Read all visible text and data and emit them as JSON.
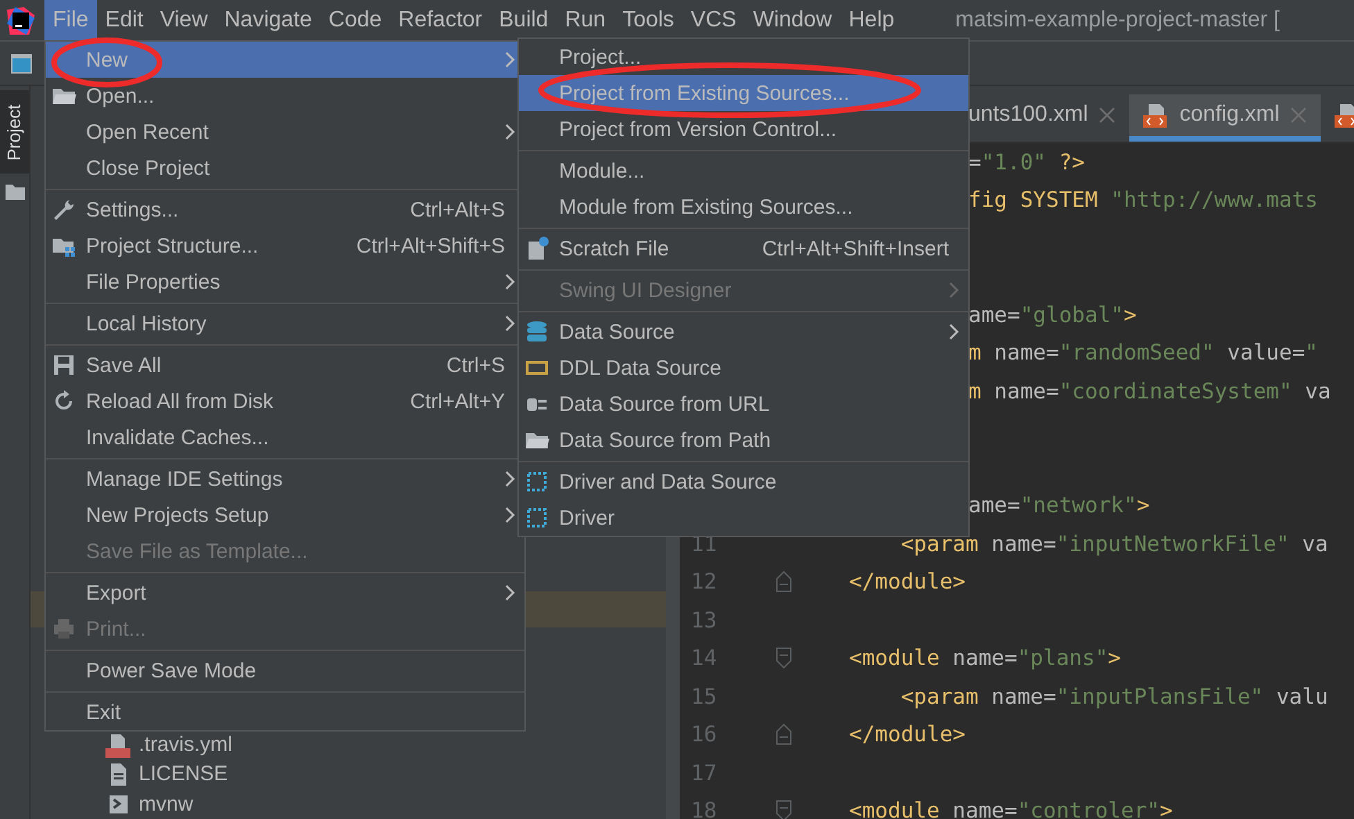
{
  "menu_bar": {
    "items": [
      {
        "label": "File",
        "selected": true
      },
      {
        "label": "Edit",
        "selected": false
      },
      {
        "label": "View",
        "selected": false
      },
      {
        "label": "Navigate",
        "selected": false
      },
      {
        "label": "Code",
        "selected": false
      },
      {
        "label": "Refactor",
        "selected": false
      },
      {
        "label": "Build",
        "selected": false
      },
      {
        "label": "Run",
        "selected": false
      },
      {
        "label": "Tools",
        "selected": false
      },
      {
        "label": "VCS",
        "selected": false
      },
      {
        "label": "Window",
        "selected": false
      },
      {
        "label": "Help",
        "selected": false
      }
    ],
    "title": "matsim-example-project-master ["
  },
  "tool_window_stripe": {
    "tab": {
      "label": "Project",
      "selected": true
    }
  },
  "project_tree": [
    {
      "label": ".travis.yml",
      "kind": "yml"
    },
    {
      "label": "LICENSE",
      "kind": "text"
    },
    {
      "label": "mvnw",
      "kind": "script"
    }
  ],
  "editor": {
    "tabs": [
      {
        "label": "unts100.xml",
        "selected": false
      },
      {
        "label": "config.xml",
        "selected": true
      },
      {
        "selected": false
      }
    ],
    "lines": [
      {
        "tokens": [
          {
            "kind": "plain",
            "text": "="
          },
          {
            "kind": "value",
            "text": "\"1.0\""
          },
          {
            "kind": "tag",
            "text": " ?>"
          }
        ]
      },
      {
        "tokens": [
          {
            "kind": "tag",
            "text": "fig SYSTEM "
          },
          {
            "kind": "value",
            "text": "\"http://www.mats"
          }
        ]
      },
      {
        "gap_before": true,
        "tokens": [
          {
            "kind": "plain",
            "text": "ame="
          },
          {
            "kind": "value",
            "text": "\"global\""
          },
          {
            "kind": "tag",
            "text": ">"
          }
        ]
      },
      {
        "tokens": [
          {
            "kind": "tag",
            "text": "m"
          },
          {
            "kind": "plain",
            "text": " name="
          },
          {
            "kind": "value",
            "text": "\"randomSeed\""
          },
          {
            "kind": "plain",
            "text": " value="
          },
          {
            "kind": "value",
            "text": "\""
          }
        ]
      },
      {
        "tokens": [
          {
            "kind": "tag",
            "text": "m"
          },
          {
            "kind": "plain",
            "text": " name="
          },
          {
            "kind": "value",
            "text": "\"coordinateSystem\""
          },
          {
            "kind": "plain",
            "text": " va"
          }
        ]
      },
      {
        "gap_before": true,
        "tokens": [
          {
            "kind": "plain",
            "text": "ame="
          },
          {
            "kind": "value",
            "text": "\"network\""
          },
          {
            "kind": "tag",
            "text": ">"
          }
        ]
      },
      {
        "number": "11",
        "fold_start": false,
        "fold_end": false,
        "tokens": [
          {
            "kind": "tag",
            "text": "    <param"
          },
          {
            "kind": "plain",
            "text": " name="
          },
          {
            "kind": "value",
            "text": "\"inputNetworkFile\""
          },
          {
            "kind": "plain",
            "text": " va"
          }
        ]
      },
      {
        "number": "12",
        "fold_start": false,
        "fold_end": true,
        "tokens": [
          {
            "kind": "tag",
            "text": "</module>"
          }
        ]
      },
      {
        "number": "13",
        "fold_start": false,
        "fold_end": false
      },
      {
        "number": "14",
        "fold_start": true,
        "fold_end": false,
        "tokens": [
          {
            "kind": "tag",
            "text": "<module"
          },
          {
            "kind": "plain",
            "text": " name="
          },
          {
            "kind": "value",
            "text": "\"plans\""
          },
          {
            "kind": "tag",
            "text": ">"
          }
        ]
      },
      {
        "number": "15",
        "fold_start": false,
        "fold_end": false,
        "tokens": [
          {
            "kind": "tag",
            "text": "    <param"
          },
          {
            "kind": "plain",
            "text": " name="
          },
          {
            "kind": "value",
            "text": "\"inputPlansFile\""
          },
          {
            "kind": "plain",
            "text": " valu"
          }
        ]
      },
      {
        "number": "16",
        "fold_start": false,
        "fold_end": true,
        "tokens": [
          {
            "kind": "tag",
            "text": "</module>"
          }
        ]
      },
      {
        "number": "17",
        "fold_start": false,
        "fold_end": false
      },
      {
        "number": "18",
        "fold_start": true,
        "fold_end": false,
        "tokens": [
          {
            "kind": "tag",
            "text": "<module"
          },
          {
            "kind": "plain",
            "text": " name="
          },
          {
            "kind": "value",
            "text": "\"controler\""
          },
          {
            "kind": "tag",
            "text": ">"
          }
        ]
      }
    ]
  },
  "file_menu": {
    "groups": [
      [
        {
          "label": "New",
          "selected": true,
          "submenu": true,
          "disabled": false
        },
        {
          "label": "Open...",
          "selected": false,
          "submenu": false,
          "disabled": false
        },
        {
          "label": "Open Recent",
          "selected": false,
          "submenu": true,
          "disabled": false
        },
        {
          "label": "Close Project",
          "selected": false,
          "submenu": false,
          "disabled": false
        }
      ],
      [
        {
          "label": "Settings...",
          "shortcut": "Ctrl+Alt+S",
          "selected": false,
          "submenu": false,
          "disabled": false
        },
        {
          "label": "Project Structure...",
          "shortcut": "Ctrl+Alt+Shift+S",
          "selected": false,
          "submenu": false,
          "disabled": false
        },
        {
          "label": "File Properties",
          "selected": false,
          "submenu": true,
          "disabled": false
        }
      ],
      [
        {
          "label": "Local History",
          "selected": false,
          "submenu": true,
          "disabled": false
        }
      ],
      [
        {
          "label": "Save All",
          "shortcut": "Ctrl+S",
          "selected": false,
          "submenu": false,
          "disabled": false
        },
        {
          "label": "Reload All from Disk",
          "shortcut": "Ctrl+Alt+Y",
          "selected": false,
          "submenu": false,
          "disabled": false
        },
        {
          "label": "Invalidate Caches...",
          "selected": false,
          "submenu": false,
          "disabled": false
        }
      ],
      [
        {
          "label": "Manage IDE Settings",
          "selected": false,
          "submenu": true,
          "disabled": false
        },
        {
          "label": "New Projects Setup",
          "selected": false,
          "submenu": true,
          "disabled": false
        },
        {
          "label": "Save File as Template...",
          "selected": false,
          "submenu": false,
          "disabled": true
        }
      ],
      [
        {
          "label": "Export",
          "selected": false,
          "submenu": true,
          "disabled": false
        },
        {
          "label": "Print...",
          "selected": false,
          "submenu": false,
          "disabled": true
        }
      ],
      [
        {
          "label": "Power Save Mode",
          "selected": false,
          "submenu": false,
          "disabled": false
        }
      ],
      [
        {
          "label": "Exit",
          "selected": false,
          "submenu": false,
          "disabled": false
        }
      ]
    ]
  },
  "new_submenu": {
    "groups": [
      [
        {
          "label": "Project...",
          "selected": false,
          "submenu": false,
          "disabled": false
        },
        {
          "label": "Project from Existing Sources...",
          "selected": true,
          "submenu": false,
          "disabled": false
        },
        {
          "label": "Project from Version Control...",
          "selected": false,
          "submenu": false,
          "disabled": false
        }
      ],
      [
        {
          "label": "Module...",
          "selected": false,
          "submenu": false,
          "disabled": false
        },
        {
          "label": "Module from Existing Sources...",
          "selected": false,
          "submenu": false,
          "disabled": false
        }
      ],
      [
        {
          "label": "Scratch File",
          "shortcut": "Ctrl+Alt+Shift+Insert",
          "selected": false,
          "submenu": false,
          "disabled": false
        }
      ],
      [
        {
          "label": "Swing UI Designer",
          "selected": false,
          "submenu": true,
          "disabled": true
        }
      ],
      [
        {
          "label": "Data Source",
          "selected": false,
          "submenu": true,
          "disabled": false
        },
        {
          "label": "DDL Data Source",
          "selected": false,
          "submenu": false,
          "disabled": false
        },
        {
          "label": "Data Source from URL",
          "selected": false,
          "submenu": false,
          "disabled": false
        },
        {
          "label": "Data Source from Path",
          "selected": false,
          "submenu": false,
          "disabled": false
        }
      ],
      [
        {
          "label": "Driver and Data Source",
          "selected": false,
          "submenu": false,
          "disabled": false
        },
        {
          "label": "Driver",
          "selected": false,
          "submenu": false,
          "disabled": false
        }
      ]
    ]
  }
}
